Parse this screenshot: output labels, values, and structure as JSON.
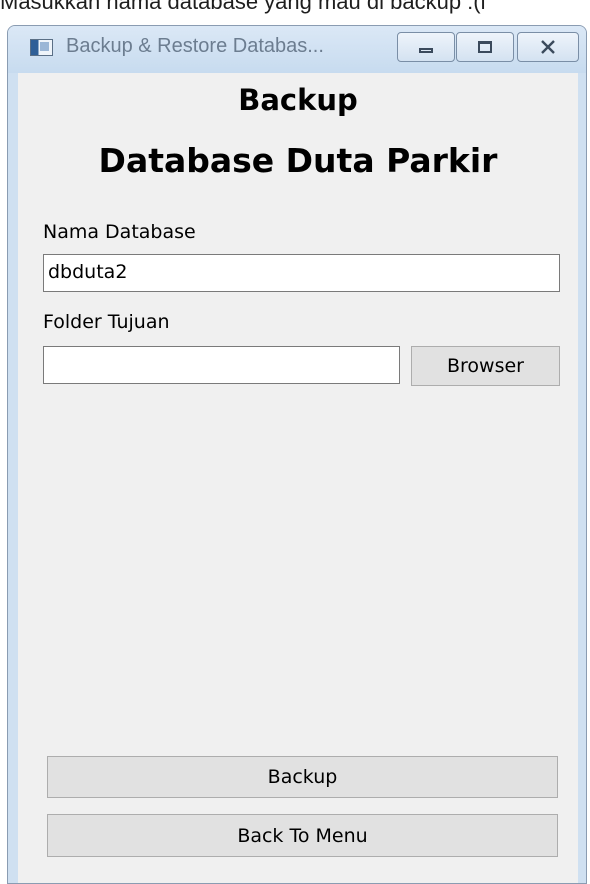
{
  "caption": "Masukkan nama database yang mau di backup :(i",
  "window": {
    "title": "Backup & Restore Databas...",
    "controls": {
      "minimize": "minimize-icon",
      "maximize": "maximize-icon",
      "close": "close-icon"
    }
  },
  "form": {
    "heading_line1": "Backup",
    "heading_line2": "Database Duta Parkir",
    "db_name_label": "Nama Database",
    "db_name_value": "dbduta2",
    "folder_label": "Folder Tujuan",
    "folder_value": "",
    "browse_label": "Browser",
    "backup_label": "Backup",
    "back_label": "Back To Menu"
  }
}
